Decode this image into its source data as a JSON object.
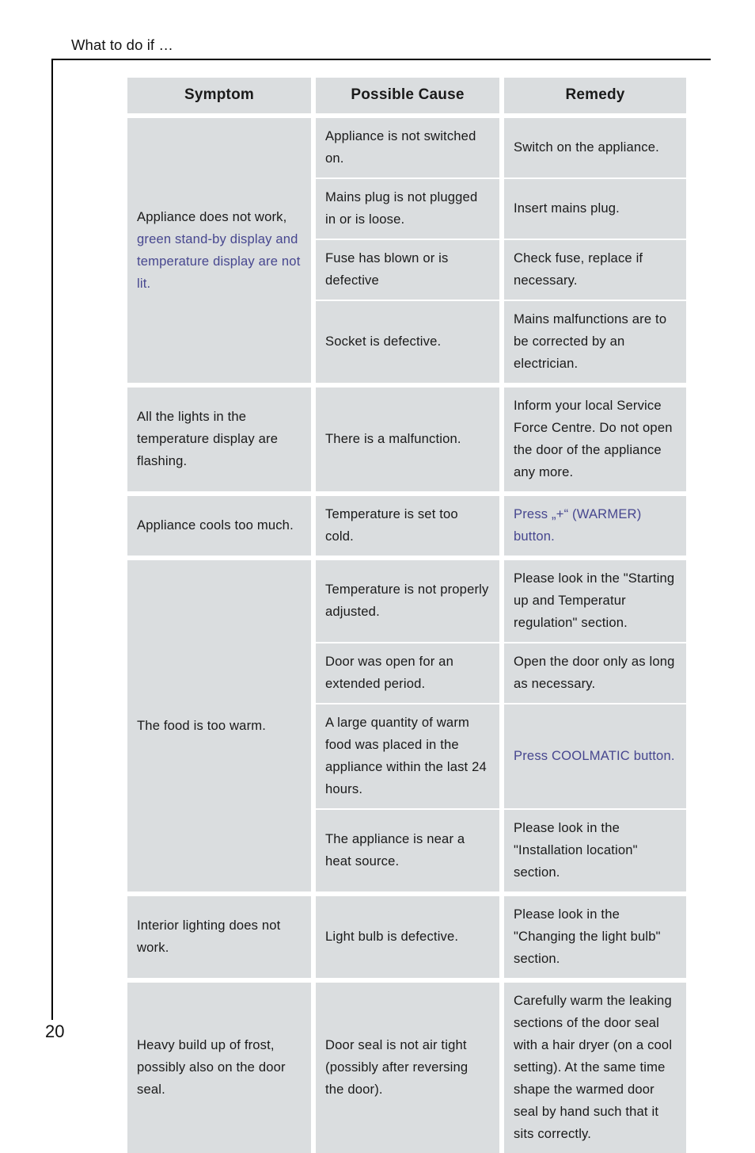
{
  "page": {
    "running_head": "What to do if …",
    "folio": "20"
  },
  "table": {
    "headers": {
      "symptom": "Symptom",
      "cause": "Possible Cause",
      "remedy": "Remedy"
    },
    "groups": [
      {
        "symptom_plain": "Appliance does not work,",
        "symptom_highlight": "green stand-by display and temperature display are not lit.",
        "pairs": [
          {
            "cause": "Appliance is not switched on.",
            "remedy": "Switch on the appliance."
          },
          {
            "cause": "Mains plug is not plugged in or is loose.",
            "remedy": "Insert mains plug."
          },
          {
            "cause": "Fuse has blown or is defective",
            "remedy": "Check fuse, replace if necessary."
          },
          {
            "cause": "Socket is defective.",
            "remedy": "Mains malfunctions are to be corrected by an electrician."
          }
        ]
      },
      {
        "symptom_plain": "All the lights in the temperature display are flashing.",
        "symptom_highlight": "",
        "pairs": [
          {
            "cause": "There is a malfunction.",
            "remedy": "Inform your local Service Force Centre. Do not open the door of the appliance any more."
          }
        ]
      },
      {
        "symptom_plain": "Appliance cools too much.",
        "symptom_highlight": "",
        "pairs": [
          {
            "cause": "Temperature is set too cold.",
            "remedy": "Press „+“ (WARMER) button.",
            "remedy_blue": true
          }
        ]
      },
      {
        "symptom_plain": "The food is too warm.",
        "symptom_highlight": "",
        "pairs": [
          {
            "cause": "Temperature is not properly adjusted.",
            "remedy": "Please look in the \"Starting up and Temperatur regulation\" section."
          },
          {
            "cause": "Door was open for an extended period.",
            "remedy": "Open the door only as long as necessary."
          },
          {
            "cause": "A large quantity of warm food was placed in the appliance within the last 24 hours.",
            "remedy": "Press COOLMATIC button.",
            "remedy_blue": true
          },
          {
            "cause": "The appliance is near a heat source.",
            "remedy": "Please look in the \"Installation location\" section."
          }
        ]
      },
      {
        "symptom_plain": "Interior lighting does not work.",
        "symptom_highlight": "",
        "pairs": [
          {
            "cause": "Light bulb is defective.",
            "remedy": "Please look in the \"Changing the light bulb\" section."
          }
        ]
      },
      {
        "symptom_plain": "Heavy build up of frost, possibly also on the door seal.",
        "symptom_highlight": "",
        "pairs": [
          {
            "cause": "Door seal is not air tight (possibly after reversing the door).",
            "remedy": "Carefully warm the leaking sections of the door seal with a hair dryer (on a cool setting). At the same time shape the warmed door seal by hand such that it sits correctly."
          }
        ]
      }
    ]
  },
  "colors": {
    "cell_background": "#dadddf",
    "highlight_text": "#47478f",
    "body_text": "#1a1a1a",
    "rule": "#000000"
  }
}
